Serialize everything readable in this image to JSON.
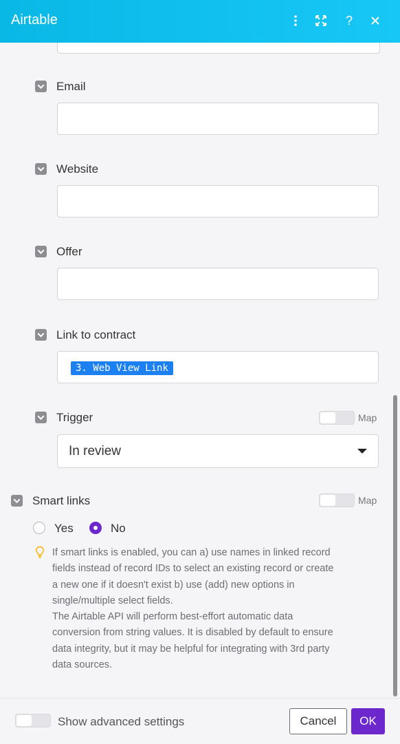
{
  "header": {
    "title": "Airtable",
    "icons": [
      "more-vertical-icon",
      "expand-icon",
      "help-icon",
      "close-icon"
    ],
    "colors": {
      "gradient_start": "#0ab8e6",
      "gradient_end": "#17c7f5"
    }
  },
  "fields": {
    "email": {
      "label": "Email",
      "value": ""
    },
    "website": {
      "label": "Website",
      "value": ""
    },
    "offer": {
      "label": "Offer",
      "value": ""
    },
    "link_to_contract": {
      "label": "Link to contract",
      "mapped_token": "3. Web View Link"
    },
    "trigger": {
      "label": "Trigger",
      "selected": "In review",
      "map_label": "Map"
    }
  },
  "smart_links": {
    "label": "Smart links",
    "map_label": "Map",
    "options": [
      "Yes",
      "No"
    ],
    "selected": "No",
    "help_lines": [
      "If smart links is enabled, you can a) use names in linked record",
      "fields instead of record IDs to select an existing record or create",
      "a new one if it doesn't exist b) use (add) new options in",
      "single/multiple select fields.",
      "The Airtable API will perform best-effort automatic data",
      "conversion from string values. It is disabled by default to ensure",
      "data integrity, but it may be helpful for integrating with 3rd party",
      "data sources."
    ]
  },
  "footer": {
    "advanced_label": "Show advanced settings",
    "cancel_label": "Cancel",
    "ok_label": "OK"
  },
  "colors": {
    "accent": "#6c28cc",
    "token": "#1c80f0"
  }
}
